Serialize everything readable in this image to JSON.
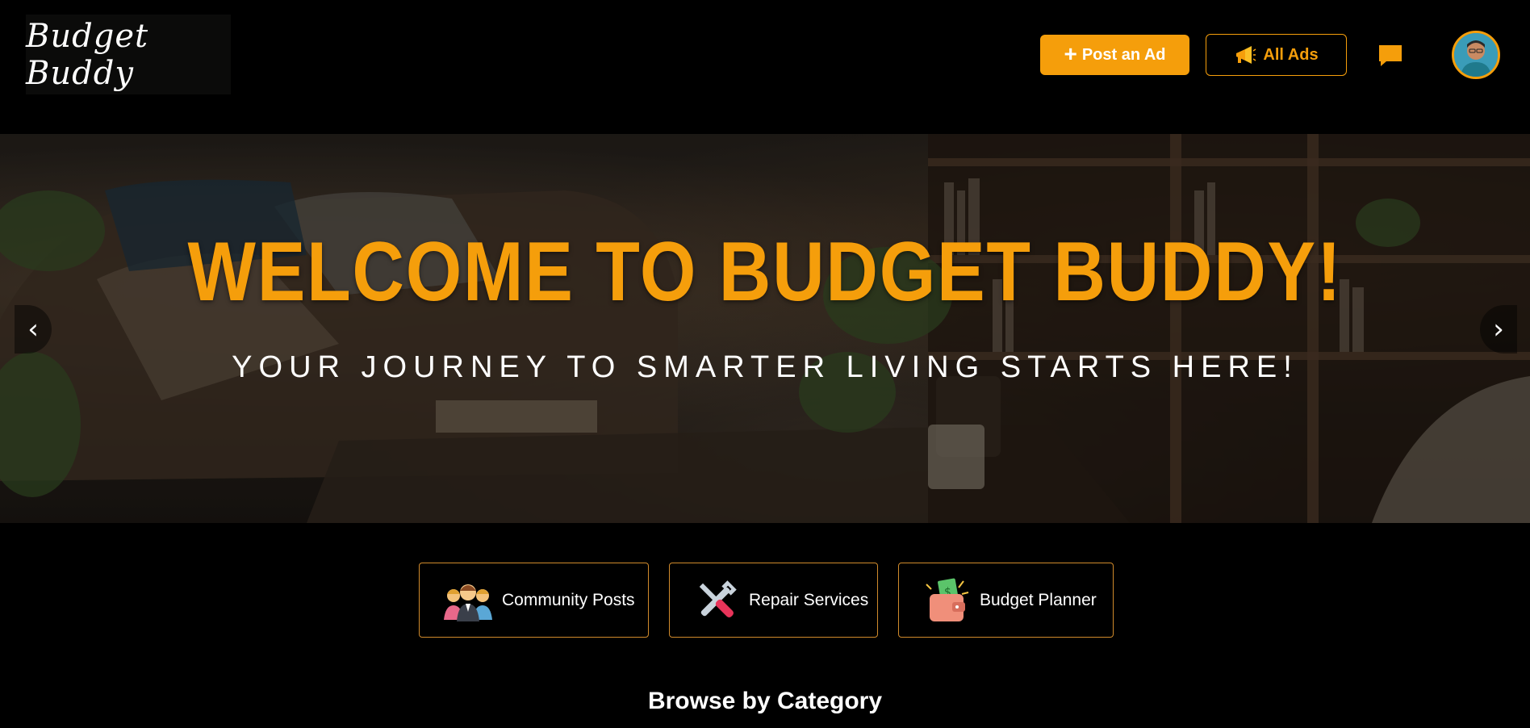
{
  "header": {
    "logo_text": "Budget Buddy",
    "post_ad_label": "Post an Ad",
    "all_ads_label": "All Ads",
    "icons": {
      "post": "plus-icon",
      "all_ads": "megaphone-icon",
      "messages": "chat-icon",
      "avatar": "user-avatar"
    }
  },
  "hero": {
    "title": "WELCOME TO BUDGET BUDDY!",
    "subtitle": "YOUR JOURNEY TO SMARTER LIVING STARTS HERE!",
    "prev_arrow": "‹",
    "next_arrow": "›"
  },
  "quick_links": [
    {
      "label": "Community Posts",
      "icon": "community-icon"
    },
    {
      "label": "Repair Services",
      "icon": "tools-icon"
    },
    {
      "label": "Budget Planner",
      "icon": "wallet-icon"
    }
  ],
  "section_title": "Browse by Category",
  "colors": {
    "accent": "#f59e0b",
    "background": "#000000",
    "card_border": "#d08a2b"
  }
}
